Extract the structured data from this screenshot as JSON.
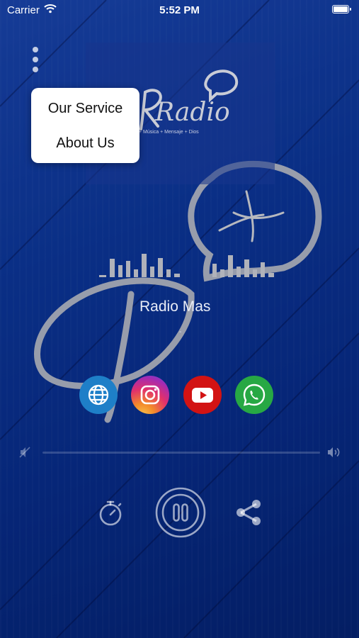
{
  "status_bar": {
    "carrier": "Carrier",
    "time": "5:52 PM",
    "wifi_icon": "wifi-icon",
    "battery_icon": "battery-icon"
  },
  "menu": {
    "icon": "more-vertical-icon",
    "items": [
      {
        "label": "Our Service"
      },
      {
        "label": "About Us"
      }
    ]
  },
  "logo": {
    "wordmark": "Radio",
    "tagline": "+ Música + Mensaje + Dios"
  },
  "station": {
    "name": "Radio Mas",
    "subtitle": "-"
  },
  "social": [
    {
      "name": "website",
      "icon": "globe-icon",
      "color": "#1e7fc8"
    },
    {
      "name": "instagram",
      "icon": "instagram-icon",
      "color": "#e1306c"
    },
    {
      "name": "youtube",
      "icon": "youtube-icon",
      "color": "#d21313"
    },
    {
      "name": "whatsapp",
      "icon": "whatsapp-icon",
      "color": "#27a844"
    }
  ],
  "volume": {
    "mute_icon": "volume-mute-icon",
    "max_icon": "volume-up-icon",
    "level": 0
  },
  "controls": {
    "timer_icon": "timer-icon",
    "play_pause_icon": "pause-icon",
    "share_icon": "share-icon",
    "state": "playing"
  },
  "colors": {
    "background": "#0b2f8f",
    "accent": "#ffffff",
    "menu_bg": "#ffffff"
  }
}
